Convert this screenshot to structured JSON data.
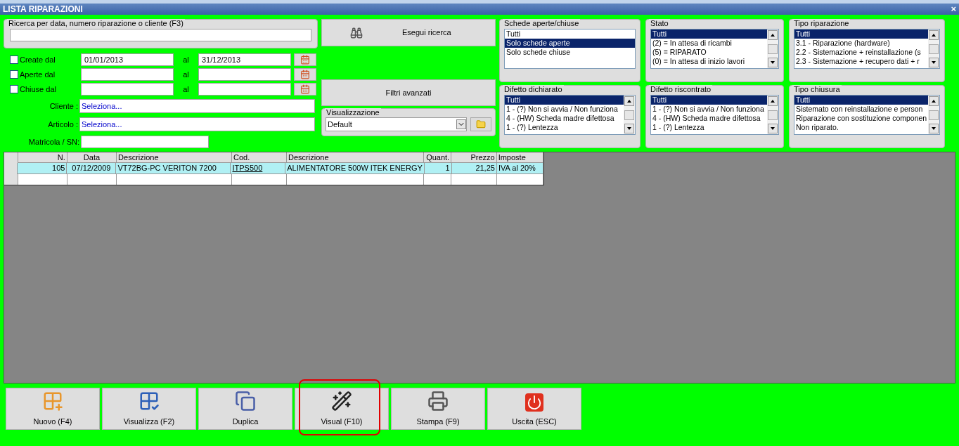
{
  "window": {
    "title": "LISTA RIPARAZIONI",
    "close": "×"
  },
  "search": {
    "legend": "Ricerca per data, numero riparazione o cliente (F3)"
  },
  "date_filters": [
    {
      "label": "Create dal",
      "checked": false,
      "from": "01/01/2013",
      "to_label": "al",
      "to": "31/12/2013"
    },
    {
      "label": "Aperte dal",
      "checked": false,
      "to_label": "al"
    },
    {
      "label": "Chiuse dal",
      "checked": false,
      "to_label": "al"
    }
  ],
  "lookups": [
    {
      "label": "Cliente :",
      "value": "Seleziona..."
    },
    {
      "label": "Articolo :",
      "value": "Seleziona..."
    }
  ],
  "serial": {
    "label": "Matricola / SN:"
  },
  "search_button": "Esegui ricerca",
  "advanced_button": "Filtri avanzati",
  "view": {
    "legend": "Visualizzazione",
    "value": "Default"
  },
  "lists": [
    {
      "title": "Schede aperte/chiuse",
      "scrollbar": false,
      "items": [
        {
          "text": "Tutti",
          "selected": false
        },
        {
          "text": "Solo schede aperte",
          "selected": true
        },
        {
          "text": "Solo schede chiuse",
          "selected": false
        }
      ]
    },
    {
      "title": "Stato",
      "scrollbar": true,
      "items": [
        {
          "text": "Tutti",
          "selected": true
        },
        {
          "text": "(2) = In attesa di ricambi",
          "selected": false
        },
        {
          "text": "(5) = RIPARATO",
          "selected": false
        },
        {
          "text": "(0) = In attesa di inizio lavori",
          "selected": false
        }
      ]
    },
    {
      "title": "Tipo riparazione",
      "scrollbar": true,
      "items": [
        {
          "text": "Tutti",
          "selected": true
        },
        {
          "text": "3.1 - Riparazione (hardware)",
          "selected": false
        },
        {
          "text": "2.2 - Sistemazione + reinstallazione (s",
          "selected": false
        },
        {
          "text": "2.3 - Sistemazione + recupero dati + r",
          "selected": false
        }
      ]
    },
    {
      "title": "Difetto dichiarato",
      "scrollbar": true,
      "items": [
        {
          "text": "Tutti",
          "selected": true
        },
        {
          "text": "1 - (?) Non si avvia / Non funziona",
          "selected": false
        },
        {
          "text": "4 - (HW) Scheda madre difettosa",
          "selected": false
        },
        {
          "text": "1 - (?) Lentezza",
          "selected": false
        }
      ]
    },
    {
      "title": "Difetto riscontrato",
      "scrollbar": true,
      "items": [
        {
          "text": "Tutti",
          "selected": true
        },
        {
          "text": "1 - (?) Non si avvia / Non funziona",
          "selected": false
        },
        {
          "text": "4 - (HW) Scheda madre difettosa",
          "selected": false
        },
        {
          "text": "1 - (?) Lentezza",
          "selected": false
        }
      ]
    },
    {
      "title": "Tipo chiusura",
      "scrollbar": true,
      "items": [
        {
          "text": "Tutti",
          "selected": true
        },
        {
          "text": "Sistemato con reinstallazione e person",
          "selected": false
        },
        {
          "text": "Riparazione con sostituzione componen",
          "selected": false
        },
        {
          "text": "Non riparato.",
          "selected": false
        }
      ]
    }
  ],
  "table": {
    "columns": [
      "N.",
      "Data",
      "Descrizione",
      "Cod.",
      "Descrizione",
      "Quant.",
      "Prezzo",
      "Imposte"
    ],
    "rows": [
      {
        "selected": true,
        "cells": [
          "105",
          "07/12/2009",
          "VT72BG-PC VERITON 7200",
          "ITPS500",
          "ALIMENTATORE 500W ITEK ENERGY",
          "1",
          "21,25",
          "IVA al 20%"
        ]
      }
    ]
  },
  "buttons": [
    {
      "kind": "new",
      "label": "Nuovo (F4)",
      "highlighted": false
    },
    {
      "kind": "view",
      "label": "Visualizza (F2)",
      "highlighted": false
    },
    {
      "kind": "copy",
      "label": "Duplica",
      "highlighted": false
    },
    {
      "kind": "visual",
      "label": "Visual (F10)",
      "highlighted": true
    },
    {
      "kind": "print",
      "label": "Stampa (F9)",
      "highlighted": false
    },
    {
      "kind": "exit",
      "label": "Uscita (ESC)",
      "highlighted": false
    }
  ]
}
